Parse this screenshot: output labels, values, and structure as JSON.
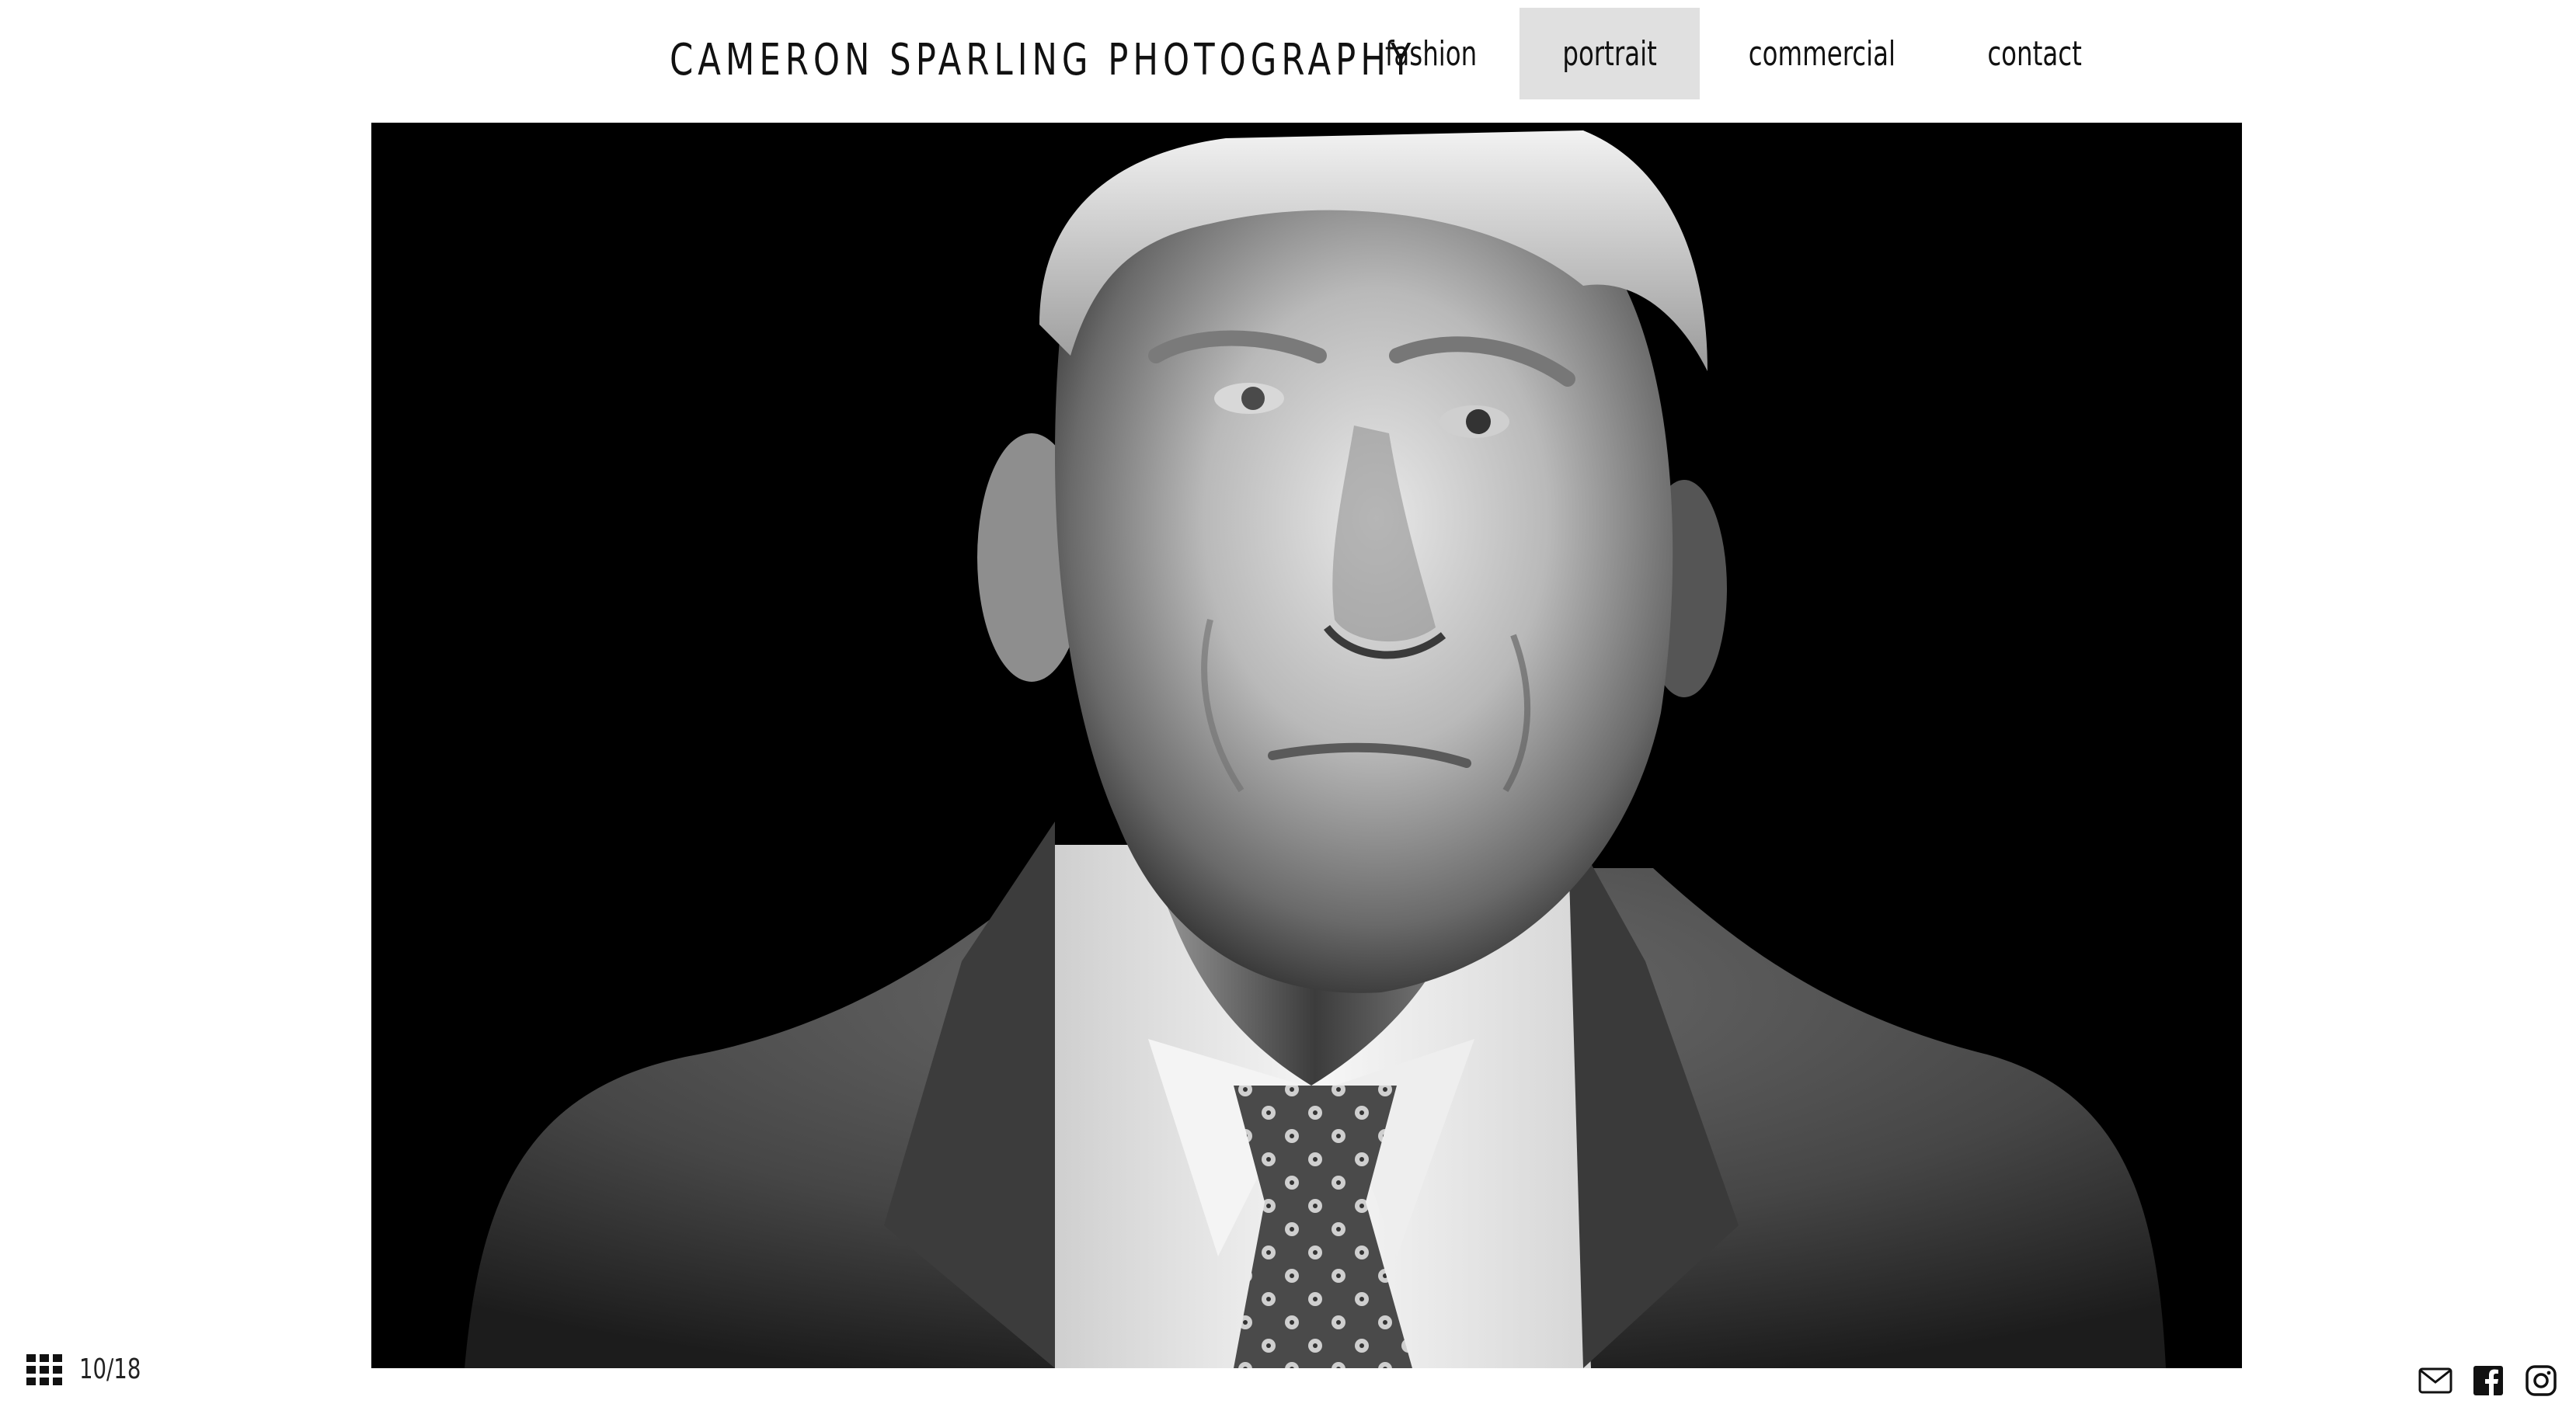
{
  "header": {
    "site_title": "CAMERON SPARLING PHOTOGRAPHY",
    "nav": [
      {
        "label": "fashion",
        "active": false
      },
      {
        "label": "portrait",
        "active": true
      },
      {
        "label": "commercial",
        "active": false
      },
      {
        "label": "contact",
        "active": false
      }
    ]
  },
  "gallery": {
    "counter": "10/18",
    "grid_icon": "grid-icon"
  },
  "social": {
    "icons": [
      "email-icon",
      "facebook-icon",
      "instagram-icon"
    ]
  },
  "colors": {
    "nav_active_bg": "#e0e0e0",
    "photo_bg": "#000000"
  }
}
